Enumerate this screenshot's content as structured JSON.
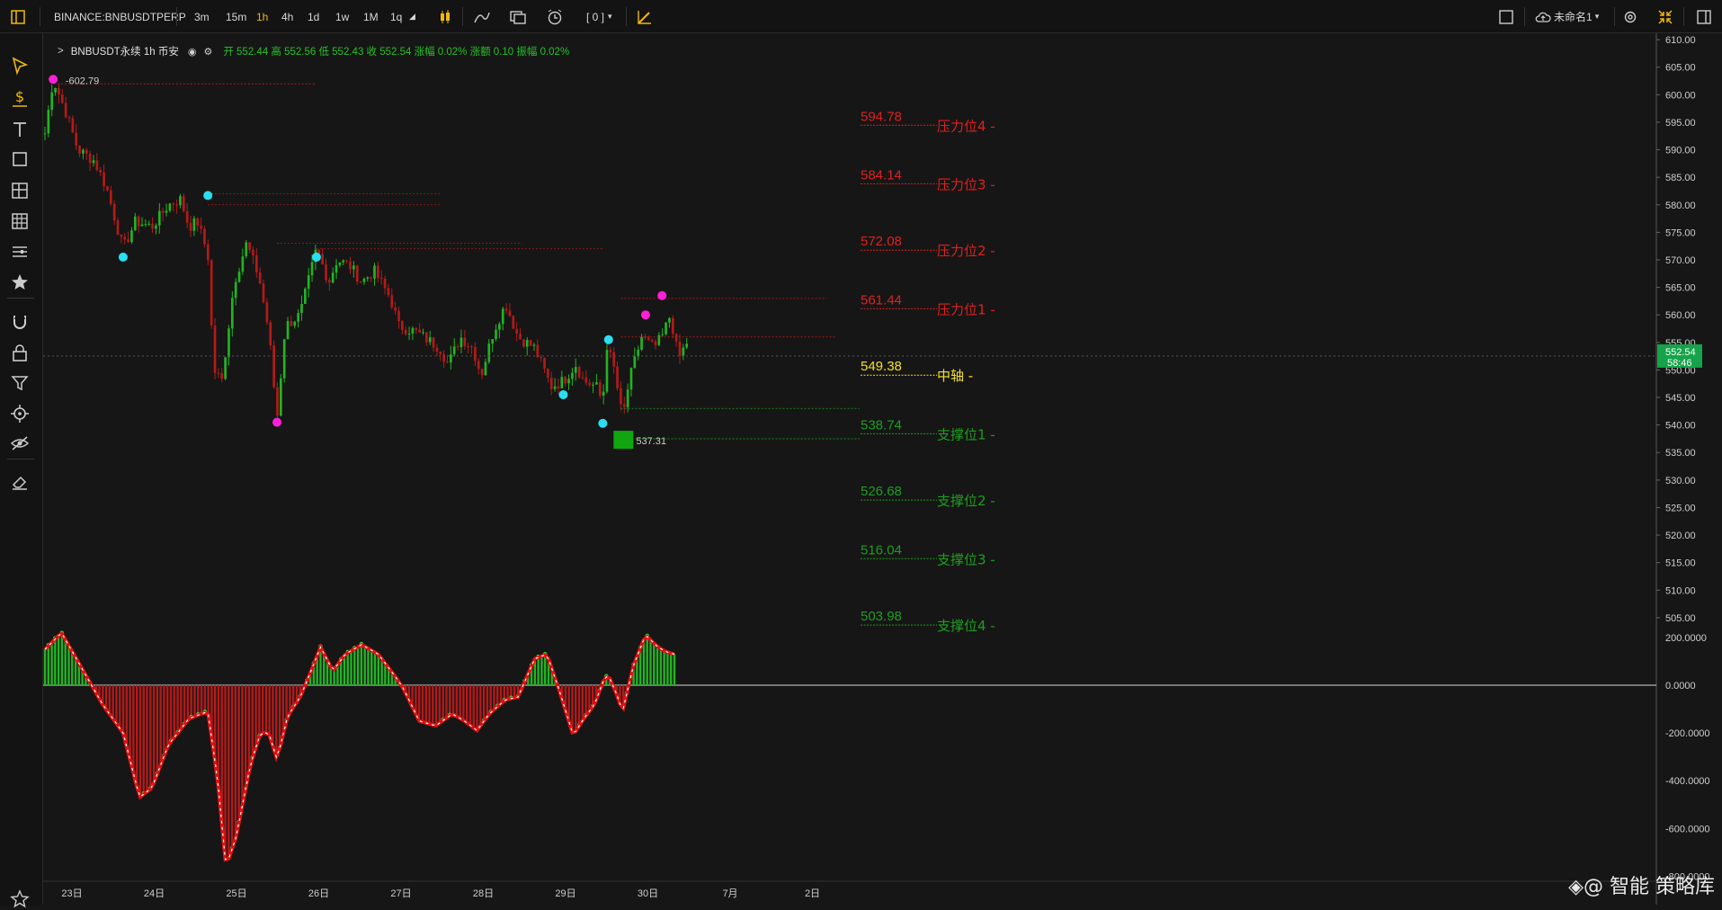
{
  "toolbar": {
    "symbol": "BINANCE:BNBUSDTPERP",
    "intervals": [
      "3m",
      "15m",
      "1h",
      "4h",
      "1d",
      "1w",
      "1M",
      "1q"
    ],
    "active_interval": "1h",
    "indicator_count": "[ 0 ]",
    "layout_name": "未命名1"
  },
  "legend": {
    "symbol_label": "BNBUSDT永续 1h 币安",
    "ohlc_text": "开 552.44 高 552.56 低 552.43 收 552.54 涨幅 0.02% 涨额 0.10 振幅 0.02%"
  },
  "colors": {
    "up": "#22b422",
    "down": "#b41a1a",
    "resistance": "#e02020",
    "support": "#1f9e1f",
    "pivot": "#f5e02a",
    "magenta": "#ff1fd8",
    "cyan": "#28e0f0"
  },
  "chart_data": {
    "type": "candlestick",
    "symbol": "BNBUSDT",
    "interval": "1h",
    "price_axis": {
      "ticks": [
        "610.00",
        "605.00",
        "600.00",
        "595.00",
        "590.00",
        "585.00",
        "580.00",
        "575.00",
        "570.00",
        "565.00",
        "560.00",
        "555.00",
        "550.00",
        "545.00",
        "540.00",
        "535.00",
        "530.00",
        "525.00",
        "520.00",
        "515.00",
        "510.00",
        "505.00"
      ],
      "range": [
        504,
        611
      ]
    },
    "last_price": "552.54",
    "countdown": "58:46",
    "high_label": "602.79",
    "low_label": "537.31",
    "x_axis_labels": [
      "23日",
      "24日",
      "25日",
      "26日",
      "27日",
      "28日",
      "29日",
      "30日",
      "7月",
      "2日"
    ],
    "levels": [
      {
        "value": "594.78",
        "label": "压力位4 -",
        "type": "resistance"
      },
      {
        "value": "584.14",
        "label": "压力位3 -",
        "type": "resistance"
      },
      {
        "value": "572.08",
        "label": "压力位2 -",
        "type": "resistance"
      },
      {
        "value": "561.44",
        "label": "压力位1 -",
        "type": "resistance"
      },
      {
        "value": "549.38",
        "label": "中轴 -",
        "type": "pivot"
      },
      {
        "value": "538.74",
        "label": "支撑位1 -",
        "type": "support"
      },
      {
        "value": "526.68",
        "label": "支撑位2 -",
        "type": "support"
      },
      {
        "value": "516.04",
        "label": "支撑位3 -",
        "type": "support"
      },
      {
        "value": "503.98",
        "label": "支撑位4 -",
        "type": "support"
      }
    ],
    "price_path": [
      [
        0,
        593
      ],
      [
        0.1,
        602.79
      ],
      [
        0.25,
        597
      ],
      [
        0.4,
        590
      ],
      [
        0.6,
        588
      ],
      [
        0.75,
        583
      ],
      [
        0.95,
        572
      ],
      [
        1.1,
        577
      ],
      [
        1.3,
        576
      ],
      [
        1.5,
        580
      ],
      [
        1.65,
        581
      ],
      [
        1.75,
        576
      ],
      [
        1.85,
        577
      ],
      [
        1.98,
        571
      ],
      [
        2.05,
        550
      ],
      [
        2.15,
        548
      ],
      [
        2.3,
        566
      ],
      [
        2.45,
        573
      ],
      [
        2.6,
        567
      ],
      [
        2.72,
        557
      ],
      [
        2.82,
        541
      ],
      [
        2.92,
        558
      ],
      [
        3.1,
        560
      ],
      [
        3.3,
        572
      ],
      [
        3.45,
        566
      ],
      [
        3.55,
        570
      ],
      [
        3.7,
        569
      ],
      [
        3.85,
        566
      ],
      [
        4.0,
        568
      ],
      [
        4.2,
        563
      ],
      [
        4.3,
        558
      ],
      [
        4.5,
        557
      ],
      [
        4.7,
        555
      ],
      [
        4.8,
        554
      ],
      [
        4.9,
        551
      ],
      [
        5.05,
        556
      ],
      [
        5.2,
        554
      ],
      [
        5.3,
        549
      ],
      [
        5.45,
        557
      ],
      [
        5.6,
        562
      ],
      [
        5.75,
        556
      ],
      [
        5.95,
        554
      ],
      [
        6.15,
        547
      ],
      [
        6.3,
        548
      ],
      [
        6.45,
        551
      ],
      [
        6.55,
        548
      ],
      [
        6.7,
        547
      ],
      [
        6.78,
        544
      ],
      [
        6.82,
        555
      ],
      [
        6.92,
        550
      ],
      [
        7.02,
        541
      ],
      [
        7.1,
        548
      ],
      [
        7.25,
        556
      ],
      [
        7.4,
        554
      ],
      [
        7.5,
        556
      ],
      [
        7.6,
        560
      ],
      [
        7.7,
        552
      ],
      [
        7.8,
        555
      ]
    ],
    "macd_axis": {
      "ticks": [
        "200.0000",
        "0.0000",
        "-200.0000",
        "-400.0000",
        "-600.0000",
        "-800.0000"
      ],
      "range": [
        -840,
        260
      ]
    },
    "macd_path": [
      [
        0,
        150
      ],
      [
        0.2,
        220
      ],
      [
        0.45,
        70
      ],
      [
        0.7,
        -80
      ],
      [
        0.95,
        -200
      ],
      [
        1.15,
        -470
      ],
      [
        1.3,
        -430
      ],
      [
        1.5,
        -250
      ],
      [
        1.75,
        -140
      ],
      [
        1.98,
        -110
      ],
      [
        2.1,
        -400
      ],
      [
        2.2,
        -760
      ],
      [
        2.32,
        -640
      ],
      [
        2.5,
        -330
      ],
      [
        2.62,
        -200
      ],
      [
        2.72,
        -200
      ],
      [
        2.82,
        -310
      ],
      [
        2.95,
        -130
      ],
      [
        3.1,
        -50
      ],
      [
        3.2,
        30
      ],
      [
        3.35,
        160
      ],
      [
        3.5,
        60
      ],
      [
        3.65,
        130
      ],
      [
        3.85,
        170
      ],
      [
        4.05,
        130
      ],
      [
        4.25,
        40
      ],
      [
        4.35,
        -10
      ],
      [
        4.55,
        -150
      ],
      [
        4.75,
        -170
      ],
      [
        4.95,
        -120
      ],
      [
        5.1,
        -150
      ],
      [
        5.25,
        -190
      ],
      [
        5.4,
        -120
      ],
      [
        5.6,
        -60
      ],
      [
        5.75,
        -50
      ],
      [
        5.95,
        110
      ],
      [
        6.1,
        130
      ],
      [
        6.25,
        -20
      ],
      [
        6.42,
        -210
      ],
      [
        6.55,
        -140
      ],
      [
        6.68,
        -80
      ],
      [
        6.8,
        30
      ],
      [
        6.85,
        40
      ],
      [
        6.95,
        -40
      ],
      [
        7.02,
        -110
      ],
      [
        7.15,
        80
      ],
      [
        7.3,
        210
      ],
      [
        7.45,
        160
      ],
      [
        7.55,
        140
      ],
      [
        7.65,
        130
      ]
    ],
    "macd_ticks_show": true
  },
  "leftbar_icons": [
    "cursor-icon",
    "dollar-icon",
    "text-icon",
    "rectangle-icon",
    "grid-layout-icon",
    "table-icon",
    "lines-icon",
    "star-icon",
    "magnet-icon",
    "lock-icon",
    "filter-icon",
    "target-icon",
    "eye-slash-icon",
    "eraser-icon",
    "favorite-icon"
  ],
  "watermark": "◈@ 智能 策略库"
}
